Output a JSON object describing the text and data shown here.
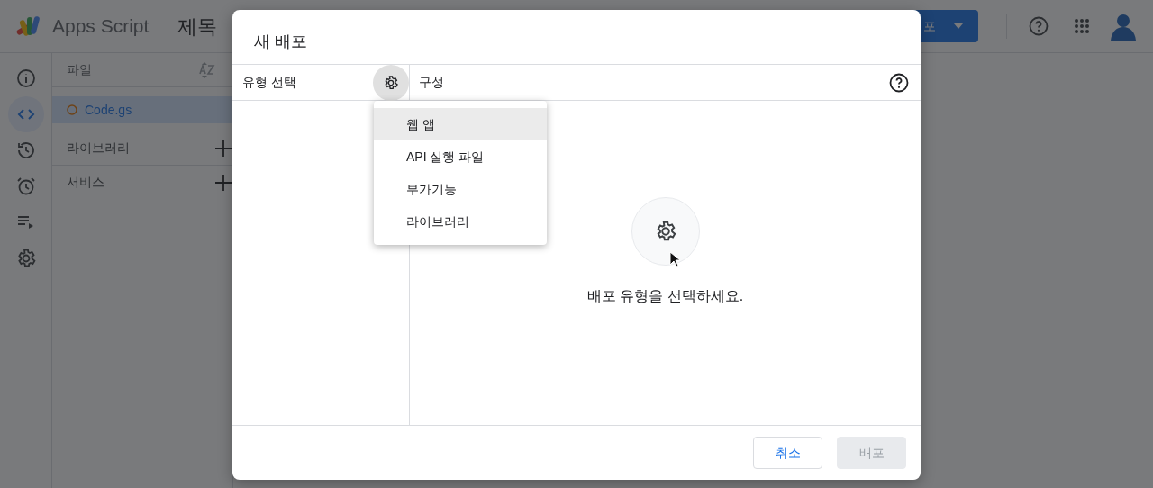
{
  "app": {
    "logo_text": "Apps Script",
    "title": "제목",
    "deploy_button": "포",
    "rail": [
      {
        "kind": "info",
        "selected": false
      },
      {
        "kind": "code",
        "selected": true
      },
      {
        "kind": "history",
        "selected": false
      },
      {
        "kind": "alarm",
        "selected": false
      },
      {
        "kind": "runs",
        "selected": false
      },
      {
        "kind": "settings",
        "selected": false
      }
    ]
  },
  "files_panel": {
    "header": "파일",
    "files": [
      {
        "name": "Code.gs",
        "selected": true
      }
    ],
    "sections": [
      "라이브러리",
      "서비스"
    ]
  },
  "dialog": {
    "title": "새 배포",
    "type_header": "유형 선택",
    "config_header": "구성",
    "menu": [
      {
        "label": "웹 앱",
        "selected": true
      },
      {
        "label": "API 실행 파일",
        "selected": false
      },
      {
        "label": "부가기능",
        "selected": false
      },
      {
        "label": "라이브러리",
        "selected": false
      }
    ],
    "empty_message": "배포 유형을 선택하세요.",
    "buttons": [
      {
        "label": "취소",
        "disabled": false
      },
      {
        "label": "배포",
        "disabled": true
      }
    ]
  }
}
